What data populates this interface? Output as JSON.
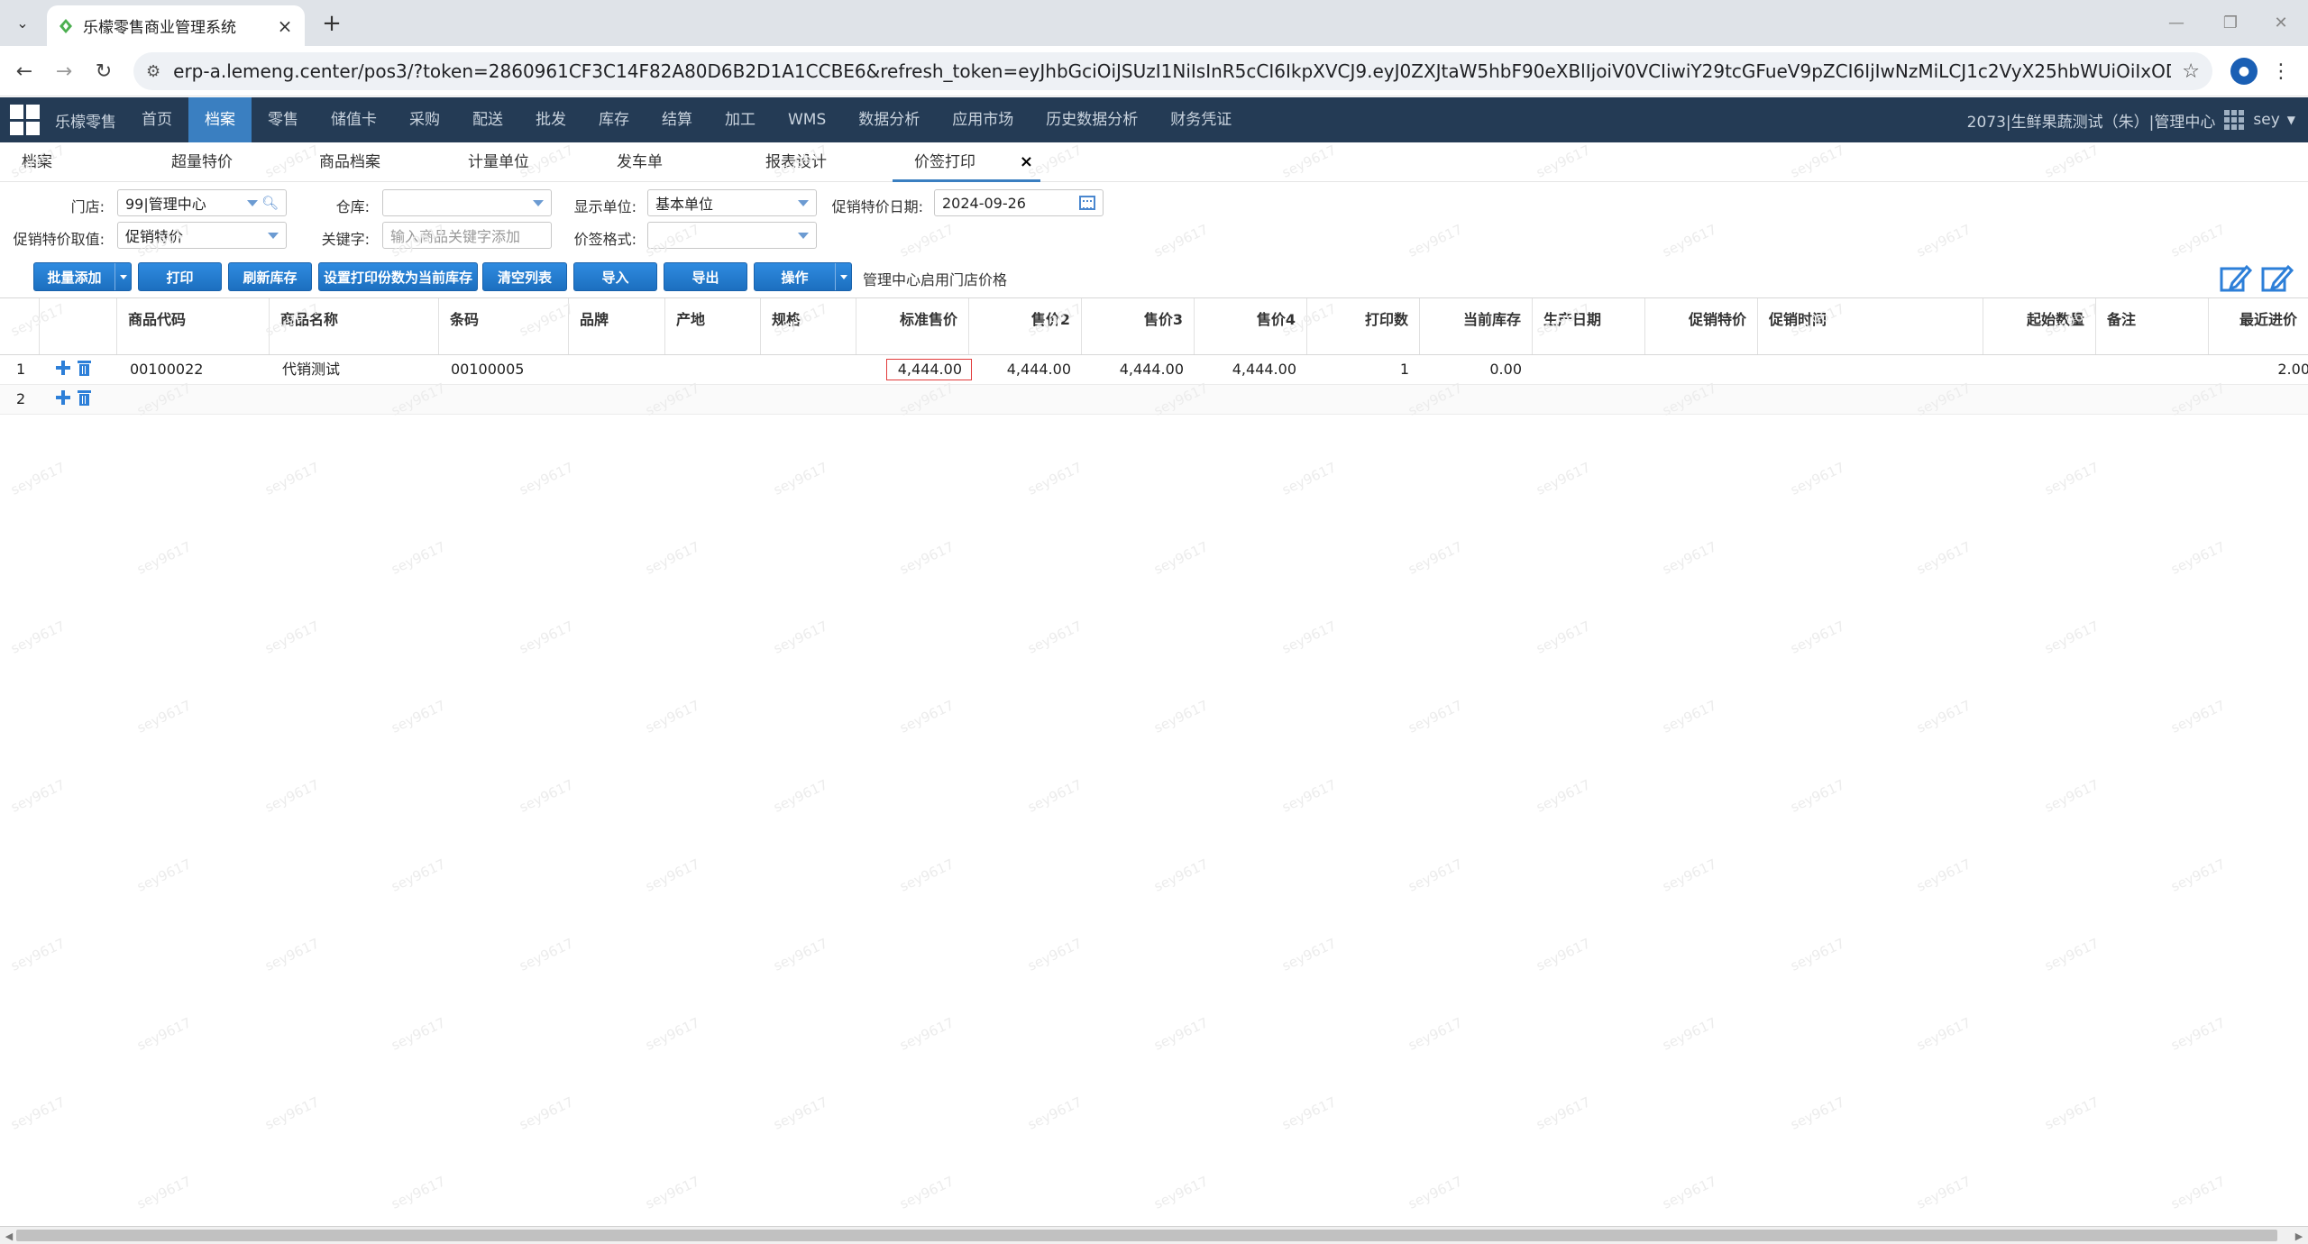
{
  "browser": {
    "tab_title": "乐檬零售商业管理系统",
    "url": "erp-a.lemeng.center/pos3/?token=2860961CF3C14F82A80D6B2D1A1CCBE6&refresh_token=eyJhbGciOiJSUzI1NiIsInR5cCI6IkpXVCJ9.eyJ0ZXJtaW5hbF90eXBlIjoiV0VCIiwiY29tcGFueV9pZCI6IjIwNzMiLCJ1c2VyX25hbWUiOiIxODk2NzgyOTYxNyIsImNvbXBhbnlfdXNlc..."
  },
  "app": {
    "brand": "乐檬零售",
    "menu": [
      "首页",
      "档案",
      "零售",
      "储值卡",
      "采购",
      "配送",
      "批发",
      "库存",
      "结算",
      "加工",
      "WMS",
      "数据分析",
      "应用市场",
      "历史数据分析",
      "财务凭证"
    ],
    "active_menu": "档案",
    "account": "2073|生鲜果蔬测试（朱）|管理中心",
    "user": "sey"
  },
  "subtabs": [
    "档案",
    "超量特价",
    "商品档案",
    "计量单位",
    "发车单",
    "报表设计",
    "价签打印"
  ],
  "active_subtab": "价签打印",
  "filters": {
    "store_label": "门店:",
    "store_value": "99|管理中心",
    "warehouse_label": "仓库:",
    "warehouse_value": "",
    "unit_label": "显示单位:",
    "unit_value": "基本单位",
    "promo_date_label": "促销特价日期:",
    "promo_date_value": "2024-09-26",
    "promo_price_label": "促销特价取值:",
    "promo_price_value": "促销特价",
    "keyword_label": "关键字:",
    "keyword_placeholder": "输入商品关键字添加",
    "format_label": "价签格式:",
    "format_value": ""
  },
  "toolbar": {
    "batch_add": "批量添加",
    "print": "打印",
    "refresh_stock": "刷新库存",
    "set_print_qty": "设置打印份数为当前库存",
    "clear_list": "清空列表",
    "import": "导入",
    "export": "导出",
    "operation": "操作",
    "note": "管理中心启用门店价格"
  },
  "grid": {
    "headers": [
      "商品代码",
      "商品名称",
      "条码",
      "品牌",
      "产地",
      "规格",
      "标准售价",
      "售价2",
      "售价3",
      "售价4",
      "打印数",
      "当前库存",
      "生产日期",
      "促销特价",
      "促销时间",
      "起始数量",
      "备注",
      "最近进价"
    ],
    "rows": [
      {
        "no": "1",
        "code": "00100022",
        "name": "代销测试",
        "barcode": "00100005",
        "brand": "",
        "origin": "",
        "spec": "",
        "std_price": "4,444.00",
        "price2": "4,444.00",
        "price3": "4,444.00",
        "price4": "4,444.00",
        "print_qty": "1",
        "stock": "0.00",
        "last_cost": "2.00"
      },
      {
        "no": "2",
        "code": "",
        "name": "",
        "barcode": "",
        "brand": "",
        "origin": "",
        "spec": "",
        "std_price": "",
        "price2": "",
        "price3": "",
        "price4": "",
        "print_qty": "",
        "stock": "",
        "last_cost": ""
      }
    ]
  },
  "watermark": "sey9617",
  "colors": {
    "nav_bg": "#243b55",
    "accent": "#3a7fc1",
    "button": "#1c6fbf",
    "highlight_border": "#e23b3b"
  }
}
